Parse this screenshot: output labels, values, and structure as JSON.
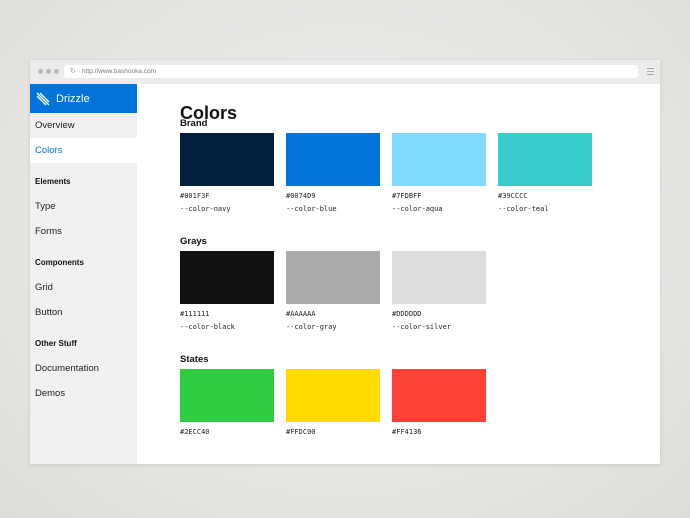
{
  "browser": {
    "url": "http://www.bashooka.com"
  },
  "sidebar": {
    "brand": "Drizzle",
    "items": [
      {
        "type": "item",
        "label": "Overview",
        "active": false
      },
      {
        "type": "item",
        "label": "Colors",
        "active": true
      },
      {
        "type": "section",
        "label": "Elements"
      },
      {
        "type": "item",
        "label": "Type",
        "active": false
      },
      {
        "type": "item",
        "label": "Forms",
        "active": false
      },
      {
        "type": "section",
        "label": "Components"
      },
      {
        "type": "item",
        "label": "Grid",
        "active": false
      },
      {
        "type": "item",
        "label": "Button",
        "active": false
      },
      {
        "type": "section",
        "label": "Other Stuff"
      },
      {
        "type": "item",
        "label": "Documentation",
        "active": false
      },
      {
        "type": "item",
        "label": "Demos",
        "active": false
      }
    ]
  },
  "main": {
    "title": "Colors",
    "groups": [
      {
        "title": "Brand",
        "swatches": [
          {
            "hex": "#001F3F",
            "var": "--color-navy",
            "color": "#001f3f"
          },
          {
            "hex": "#0074D9",
            "var": "--color-blue",
            "color": "#0074d9"
          },
          {
            "hex": "#7FDBFF",
            "var": "--color-aqua",
            "color": "#7fdbff"
          },
          {
            "hex": "#39CCCC",
            "var": "--color-teal",
            "color": "#39cccc"
          }
        ]
      },
      {
        "title": "Grays",
        "swatches": [
          {
            "hex": "#111111",
            "var": "--color-black",
            "color": "#111111"
          },
          {
            "hex": "#AAAAAA",
            "var": "--color-gray",
            "color": "#aaaaaa"
          },
          {
            "hex": "#DDDDDD",
            "var": "--color-silver",
            "color": "#dddddd"
          }
        ]
      },
      {
        "title": "States",
        "swatches": [
          {
            "hex": "#2ECC40",
            "var": "",
            "color": "#2ecc40"
          },
          {
            "hex": "#FFDC00",
            "var": "",
            "color": "#ffdc00"
          },
          {
            "hex": "#FF4136",
            "var": "",
            "color": "#ff4136"
          }
        ]
      }
    ]
  }
}
